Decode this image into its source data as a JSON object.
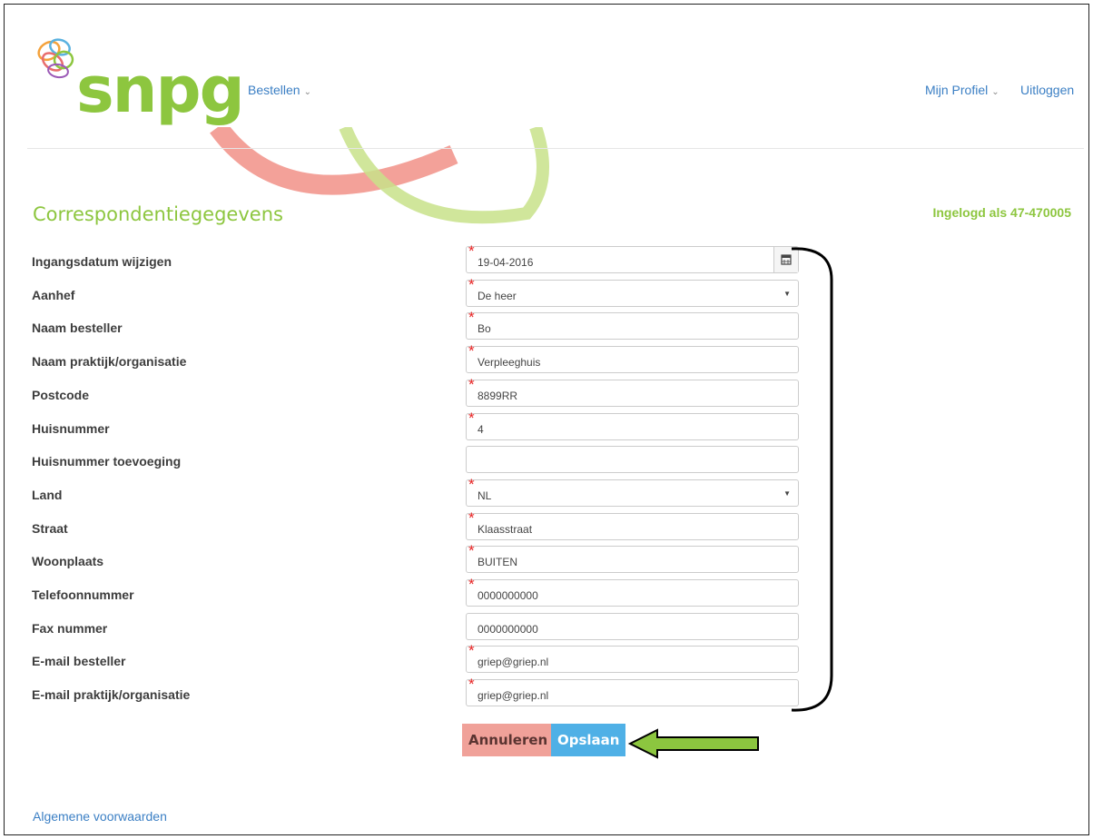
{
  "brand": {
    "logo_text": "snpg"
  },
  "nav": {
    "order_menu": "Bestellen",
    "profile_menu": "Mijn Profiel",
    "logout": "Uitloggen"
  },
  "page": {
    "title": "Correspondentiegegevens",
    "logged_in_as": "Ingelogd als 47-470005"
  },
  "form": {
    "fields": [
      {
        "label": "Ingangsdatum wijzigen",
        "value": "19-04-2016",
        "required": true,
        "type": "date"
      },
      {
        "label": "Aanhef",
        "value": "De heer",
        "required": true,
        "type": "select"
      },
      {
        "label": "Naam besteller",
        "value": "Bo",
        "required": true,
        "type": "text"
      },
      {
        "label": "Naam praktijk/organisatie",
        "value": "Verpleeghuis",
        "required": true,
        "type": "text"
      },
      {
        "label": "Postcode",
        "value": "8899RR",
        "required": true,
        "type": "text"
      },
      {
        "label": "Huisnummer",
        "value": "4",
        "required": true,
        "type": "text"
      },
      {
        "label": "Huisnummer toevoeging",
        "value": "",
        "required": false,
        "type": "text"
      },
      {
        "label": "Land",
        "value": "NL",
        "required": true,
        "type": "select"
      },
      {
        "label": "Straat",
        "value": "Klaasstraat",
        "required": true,
        "type": "text"
      },
      {
        "label": "Woonplaats",
        "value": "BUITEN",
        "required": true,
        "type": "text"
      },
      {
        "label": "Telefoonnummer",
        "value": "0000000000",
        "required": true,
        "type": "text"
      },
      {
        "label": "Fax nummer",
        "value": "0000000000",
        "required": false,
        "type": "text"
      },
      {
        "label": "E-mail besteller",
        "value": "griep@griep.nl",
        "required": true,
        "type": "text"
      },
      {
        "label": "E-mail praktijk/organisatie",
        "value": "griep@griep.nl",
        "required": true,
        "type": "text"
      }
    ],
    "cancel_label": "Annuleren",
    "save_label": "Opslaan"
  },
  "footer": {
    "terms_link": "Algemene voorwaarden"
  },
  "colors": {
    "brand_green": "#8dc63f",
    "link_blue": "#3b7fc4",
    "cancel_button": "#f0a199",
    "save_button": "#4fb0e6",
    "required_marker": "#e82323",
    "annotation_arrow": "#8cc63f"
  },
  "icons": [
    "calendar-icon",
    "chevron-down-icon",
    "dropdown-caret-icon",
    "required-asterisk-icon"
  ]
}
